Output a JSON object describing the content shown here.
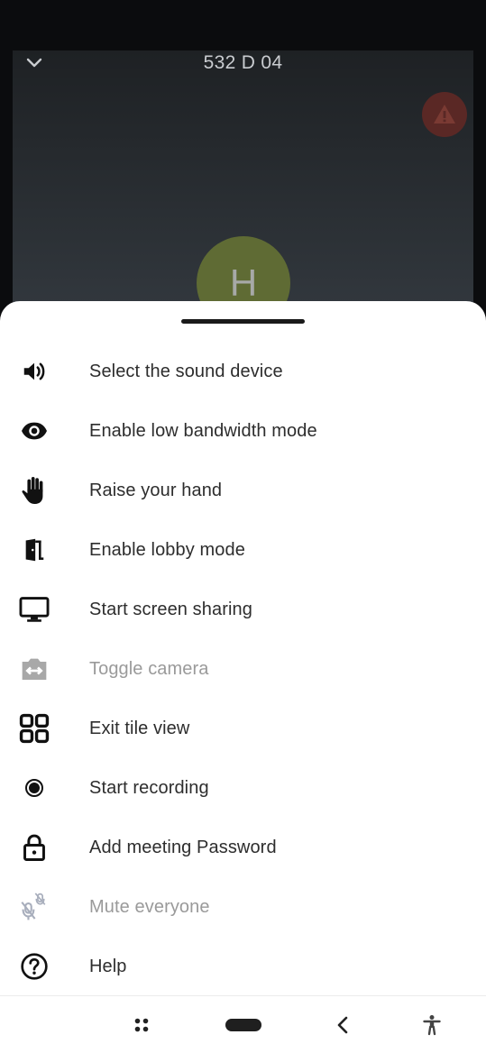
{
  "meeting": {
    "room_name": "532 D 04",
    "avatar_initial": "H",
    "colors": {
      "avatar": "#5f6b34",
      "warning_bg": "#5a2825",
      "warning_icon": "#7a3a33"
    }
  },
  "menu": {
    "items": [
      {
        "label": "Select the sound device",
        "icon": "volume-icon"
      },
      {
        "label": "Enable low bandwidth mode",
        "icon": "eye-icon"
      },
      {
        "label": "Raise your hand",
        "icon": "hand-icon"
      },
      {
        "label": "Enable lobby mode",
        "icon": "door-icon"
      },
      {
        "label": "Start screen sharing",
        "icon": "monitor-icon"
      },
      {
        "label": "Toggle camera",
        "icon": "camera-switch-icon",
        "disabled": true
      },
      {
        "label": "Exit tile view",
        "icon": "grid-icon"
      },
      {
        "label": "Start recording",
        "icon": "record-icon"
      },
      {
        "label": "Add meeting Password",
        "icon": "lock-icon"
      },
      {
        "label": "Mute everyone",
        "icon": "mic-off-icon",
        "disabled": true
      },
      {
        "label": "Help",
        "icon": "help-icon"
      }
    ]
  },
  "navbar": {
    "buttons": [
      "apps-icon",
      "home-pill",
      "back-icon",
      "accessibility-icon"
    ]
  }
}
